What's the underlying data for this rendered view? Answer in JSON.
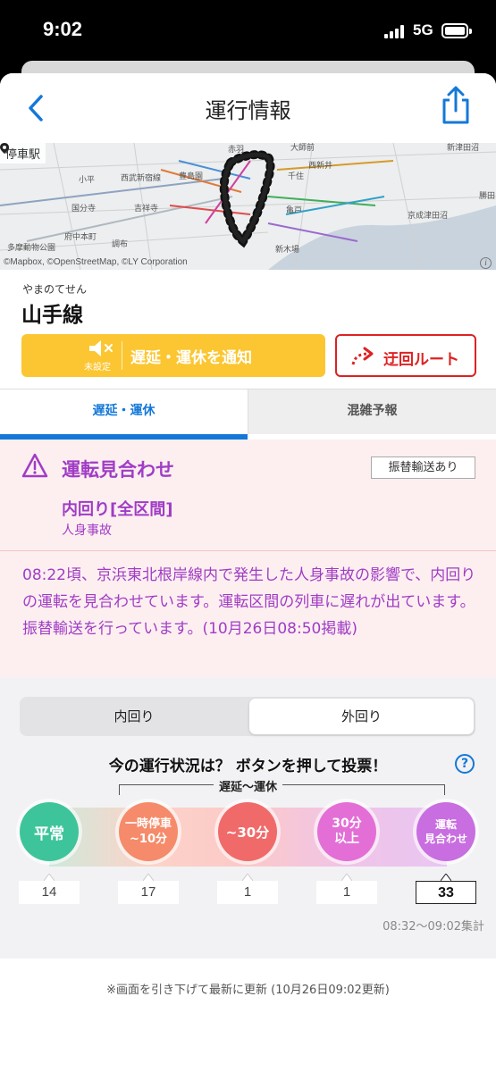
{
  "status": {
    "time": "9:02",
    "network": "5G"
  },
  "nav": {
    "title": "運行情報"
  },
  "map": {
    "station_label": "停車駅",
    "credit": "©Mapbox, ©OpenStreetMap, ©LY Corporation",
    "place_labels": [
      "赤羽",
      "大師前",
      "西新井",
      "小平",
      "西武新宿線",
      "豊島園",
      "千住",
      "国分寺",
      "吉祥寺",
      "亀戸",
      "京成津田沼",
      "府中本町",
      "調布",
      "多摩動物公園",
      "新木場",
      "勝田",
      "新津田沼"
    ]
  },
  "line": {
    "furigana": "やまのてせん",
    "name": "山手線",
    "notify_label": "遅延・運休を通知",
    "notify_status": "未設定",
    "detour_label": "迂回ルート"
  },
  "tabs": [
    {
      "label": "遅延・運休",
      "selected": true
    },
    {
      "label": "混雑予報",
      "selected": false
    }
  ],
  "alert": {
    "title": "運転見合わせ",
    "badge": "振替輸送あり",
    "section": "内回り[全区間]",
    "cause": "人身事故",
    "body": "08:22頃、京浜東北根岸線内で発生した人身事故の影響で、内回りの運転を見合わせています。運転区間の列車に遅れが出ています。振替輸送を行っています。(10月26日08:50掲載)"
  },
  "vote": {
    "segments": [
      "内回り",
      "外回り"
    ],
    "selected_segment": "外回り",
    "question": "今の運行状況は？ ボタンを押して投票！",
    "help": "?",
    "range_label": "遅延〜運休",
    "options": [
      {
        "line1": "平常",
        "line2": "",
        "count": "14"
      },
      {
        "line1": "一時停車",
        "line2": "~10分",
        "count": "17"
      },
      {
        "line1": "~30分",
        "line2": "",
        "count": "1"
      },
      {
        "line1": "30分",
        "line2": "以上",
        "count": "1"
      },
      {
        "line1": "運転",
        "line2": "見合わせ",
        "count": "33"
      }
    ],
    "aggregation": "08:32〜09:02集計"
  },
  "footer": {
    "note": "※画面を引き下げて最新に更新 (10月26日09:02更新)"
  },
  "colors": {
    "accent": "#1478d8",
    "alert_text": "#a03cc6",
    "notify_bg": "#fbc631",
    "detour": "#dd2222"
  }
}
